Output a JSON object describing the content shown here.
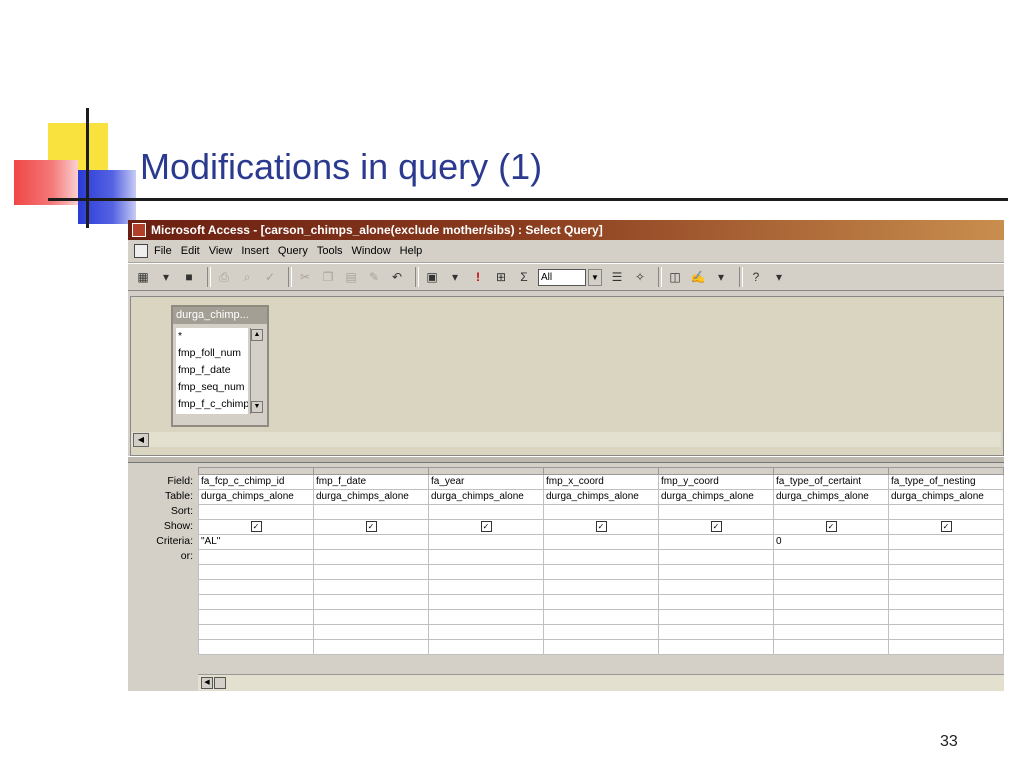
{
  "slide": {
    "title": "Modifications in query (1)",
    "page_number": "33"
  },
  "window": {
    "title": "Microsoft Access - [carson_chimps_alone(exclude mother/sibs) : Select Query]"
  },
  "menu": [
    "File",
    "Edit",
    "View",
    "Insert",
    "Query",
    "Tools",
    "Window",
    "Help"
  ],
  "toolbar": {
    "top_values": "All"
  },
  "table_box": {
    "name": "durga_chimp...",
    "fields": [
      "*",
      "fmp_foll_num",
      "fmp_f_date",
      "fmp_seq_num",
      "fmp_f_c_chimp"
    ]
  },
  "grid": {
    "row_labels": [
      "Field:",
      "Table:",
      "Sort:",
      "Show:",
      "Criteria:",
      "or:"
    ],
    "columns": [
      {
        "field": "fa_fcp_c_chimp_id",
        "table": "durga_chimps_alone",
        "criteria": "\"AL\""
      },
      {
        "field": "fmp_f_date",
        "table": "durga_chimps_alone",
        "criteria": ""
      },
      {
        "field": "fa_year",
        "table": "durga_chimps_alone",
        "criteria": ""
      },
      {
        "field": "fmp_x_coord",
        "table": "durga_chimps_alone",
        "criteria": ""
      },
      {
        "field": "fmp_y_coord",
        "table": "durga_chimps_alone",
        "criteria": ""
      },
      {
        "field": "fa_type_of_certaint",
        "table": "durga_chimps_alone",
        "criteria": "0"
      },
      {
        "field": "fa_type_of_nesting",
        "table": "durga_chimps_alone",
        "criteria": ""
      }
    ]
  }
}
